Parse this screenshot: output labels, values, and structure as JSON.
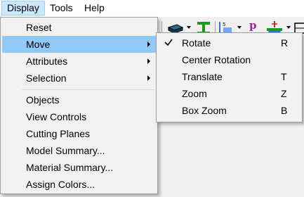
{
  "menubar": {
    "items": [
      {
        "label": "Display"
      },
      {
        "label": "Tools"
      },
      {
        "label": "Help"
      }
    ]
  },
  "display_menu": {
    "items": [
      {
        "label": "Reset"
      },
      {
        "label": "Move",
        "submenu": true,
        "highlighted": true
      },
      {
        "label": "Attributes",
        "submenu": true
      },
      {
        "label": "Selection",
        "submenu": true
      },
      {
        "label": "Objects"
      },
      {
        "label": "View Controls"
      },
      {
        "label": "Cutting Planes"
      },
      {
        "label": "Model Summary..."
      },
      {
        "label": "Material Summary..."
      },
      {
        "label": "Assign Colors..."
      }
    ]
  },
  "move_submenu": {
    "items": [
      {
        "label": "Rotate",
        "shortcut": "R",
        "checked": true
      },
      {
        "label": "Center Rotation",
        "shortcut": ""
      },
      {
        "label": "Translate",
        "shortcut": "T"
      },
      {
        "label": "Zoom",
        "shortcut": "Z"
      },
      {
        "label": "Box Zoom",
        "shortcut": "B"
      }
    ]
  },
  "toolbar": {
    "icons": [
      "layer-icon",
      "i-beam-icon",
      "section-view-icon",
      "p-icon",
      "support-icon",
      "frame-icon"
    ],
    "p_label": "p"
  },
  "colors": {
    "highlight": "#91c9f7",
    "menubar_open": "#cce8ff",
    "ibeam": "#1a9a1a",
    "p_icon": "#a020a0"
  }
}
